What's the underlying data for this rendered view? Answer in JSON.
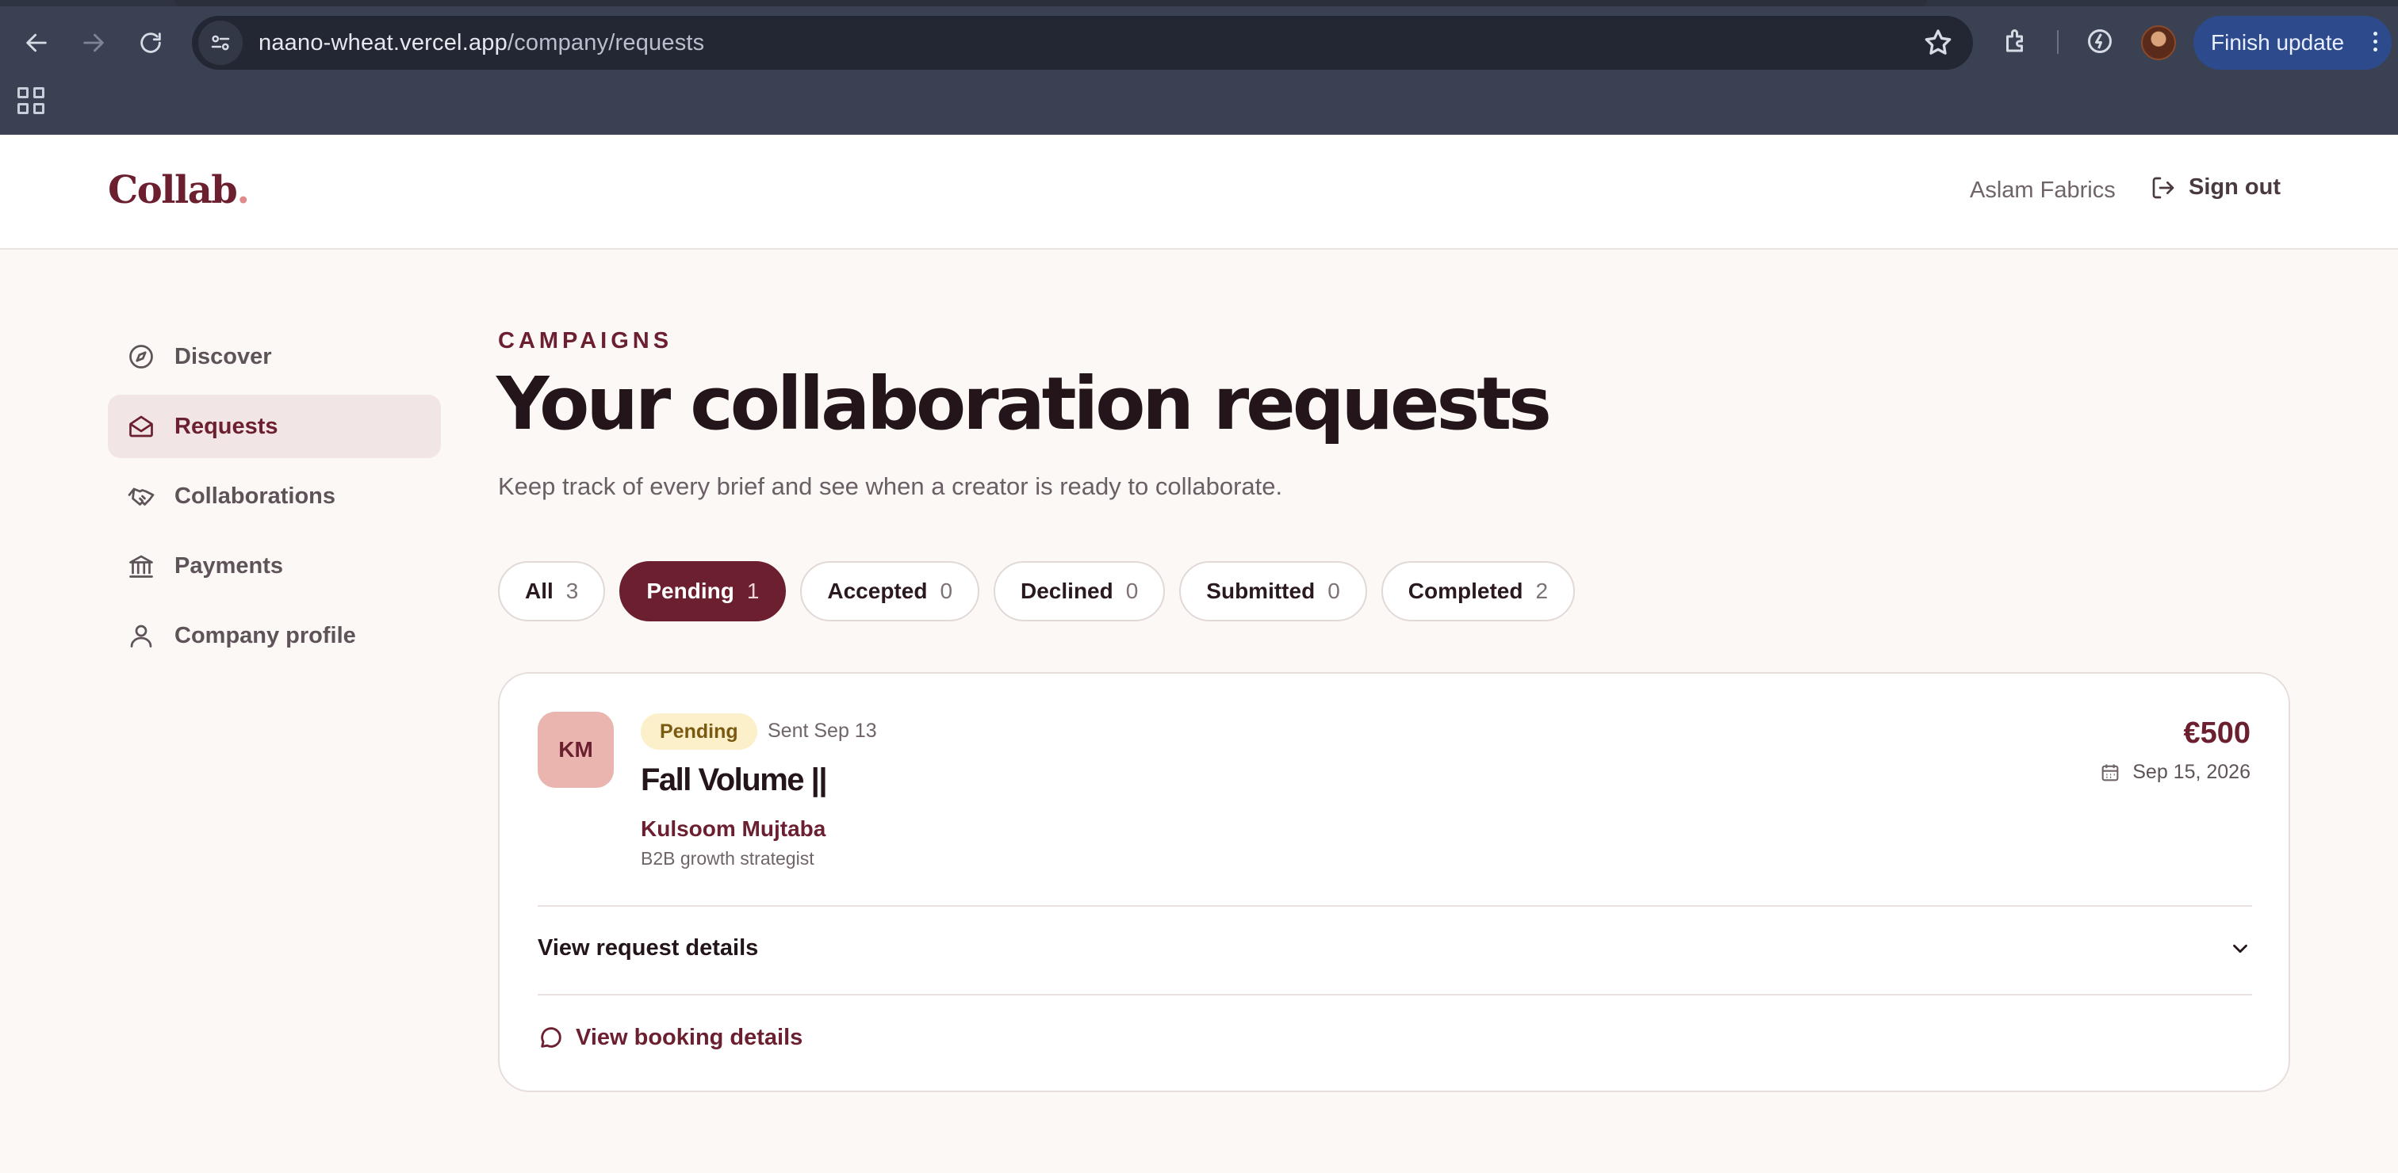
{
  "browser": {
    "url_host": "naano-wheat.vercel.app",
    "url_path": "/company/requests",
    "finish_update": "Finish update"
  },
  "header": {
    "logo": "Collab",
    "logo_dot": ".",
    "company_name": "Aslam Fabrics",
    "sign_out": "Sign out"
  },
  "sidebar": {
    "items": [
      {
        "label": "Discover",
        "icon": "compass-icon"
      },
      {
        "label": "Requests",
        "icon": "envelope-icon",
        "active": true
      },
      {
        "label": "Collaborations",
        "icon": "handshake-icon"
      },
      {
        "label": "Payments",
        "icon": "bank-icon"
      },
      {
        "label": "Company profile",
        "icon": "user-icon"
      }
    ]
  },
  "main": {
    "eyebrow": "CAMPAIGNS",
    "title": "Your collaboration requests",
    "subtitle": "Keep track of every brief and see when a creator is ready to collaborate.",
    "filters": [
      {
        "label": "All",
        "count": "3"
      },
      {
        "label": "Pending",
        "count": "1",
        "active": true
      },
      {
        "label": "Accepted",
        "count": "0"
      },
      {
        "label": "Declined",
        "count": "0"
      },
      {
        "label": "Submitted",
        "count": "0"
      },
      {
        "label": "Completed",
        "count": "2"
      }
    ]
  },
  "request_card": {
    "avatar_initials": "KM",
    "status": "Pending",
    "sent": "Sent Sep 13",
    "campaign_title": "Fall Volume ||",
    "creator_name": "Kulsoom Mujtaba",
    "creator_role": "B2B growth strategist",
    "price": "€500",
    "due_date": "Sep 15, 2026",
    "view_request_details": "View request details",
    "view_booking_details": "View booking details"
  },
  "colors": {
    "brand": "#6b1f2f",
    "page_bg": "#fcf8f6",
    "pending_badge_bg": "#fbf0c9",
    "chrome_bg": "#3a4152",
    "finish_update_bg": "#2c4a8c"
  }
}
